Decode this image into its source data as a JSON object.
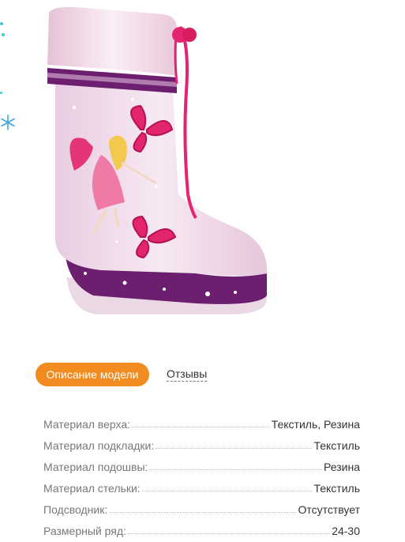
{
  "tabs": {
    "description_label": "Описание модели",
    "reviews_label": "Отзывы"
  },
  "specs": [
    {
      "label": "Материал верха:",
      "value": "Текстиль, Резина"
    },
    {
      "label": "Материал подкладки:",
      "value": "Текстиль"
    },
    {
      "label": "Материал подошвы:",
      "value": "Резина"
    },
    {
      "label": "Материал стельки:",
      "value": "Текстиль"
    },
    {
      "label": "Подсводник:",
      "value": "Отсутствует"
    },
    {
      "label": "Размерный ряд:",
      "value": "24-30"
    }
  ],
  "colors": {
    "accent": "#f28b20",
    "boot_pink": "#f2dcea",
    "boot_purple": "#6b1f6e",
    "lace": "#e3246e"
  },
  "icons": [
    "snowflake-icon"
  ]
}
